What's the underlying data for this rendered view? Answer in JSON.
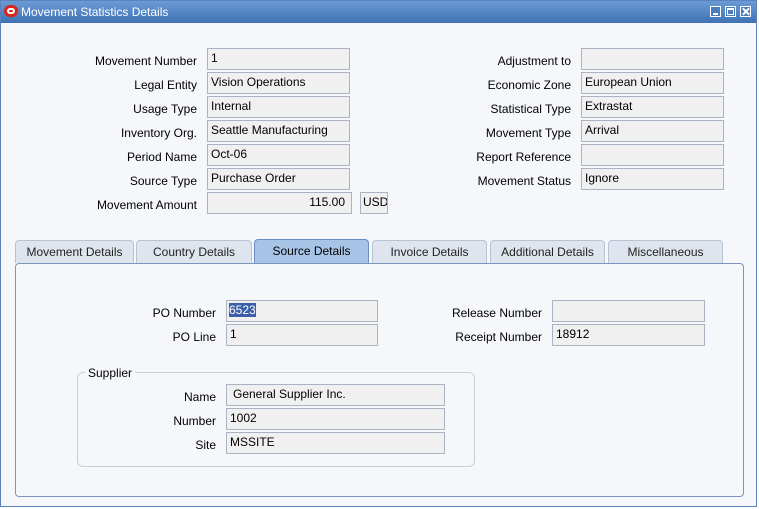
{
  "window": {
    "title": "Movement Statistics Details"
  },
  "header_left": [
    {
      "label": "Movement Number",
      "value": "1"
    },
    {
      "label": "Legal Entity",
      "value": "Vision Operations"
    },
    {
      "label": "Usage Type",
      "value": "Internal"
    },
    {
      "label": "Inventory Org.",
      "value": "Seattle Manufacturing"
    },
    {
      "label": "Period Name",
      "value": "Oct-06"
    },
    {
      "label": "Source Type",
      "value": "Purchase Order"
    },
    {
      "label": "Movement Amount",
      "value": "115.00",
      "currency": "USD"
    }
  ],
  "header_right": [
    {
      "label": "Adjustment to",
      "value": ""
    },
    {
      "label": "Economic Zone",
      "value": "European Union"
    },
    {
      "label": "Statistical Type",
      "value": "Extrastat"
    },
    {
      "label": "Movement Type",
      "value": "Arrival"
    },
    {
      "label": "Report Reference",
      "value": ""
    },
    {
      "label": "Movement Status",
      "value": "Ignore"
    }
  ],
  "tabs": [
    "Movement Details",
    "Country Details",
    "Source Details",
    "Invoice Details",
    "Additional Details",
    "Miscellaneous"
  ],
  "source_details": {
    "po_number": {
      "label": "PO Number",
      "value": "6523"
    },
    "po_line": {
      "label": "PO Line",
      "value": "1"
    },
    "release_number": {
      "label": "Release Number",
      "value": ""
    },
    "receipt_number": {
      "label": "Receipt Number",
      "value": "18912"
    },
    "supplier": {
      "title": "Supplier",
      "name": {
        "label": "Name",
        "value": "General Supplier Inc."
      },
      "number": {
        "label": "Number",
        "value": "1002"
      },
      "site": {
        "label": "Site",
        "value": "MSSITE"
      }
    }
  }
}
